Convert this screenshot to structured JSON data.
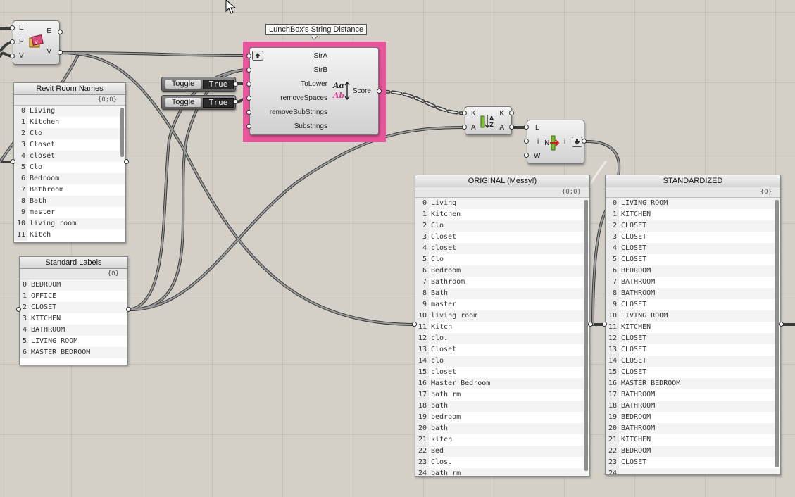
{
  "canvas": {
    "background": "#d4d0c8",
    "grid_color": "#c4c0b8",
    "highlight_color": "#e8559c"
  },
  "cursor": {
    "icon": "mouse-pointer-icon"
  },
  "object_component": {
    "inputs": [
      "E",
      "P",
      "V"
    ],
    "outputs": [
      "E",
      "V"
    ],
    "icon": "revit-object-icon"
  },
  "string_distance": {
    "tooltip": "LunchBox's String Distance",
    "inputs": [
      "StrA",
      "StrB",
      "ToLower",
      "removeSpaces",
      "removeSubStrings",
      "Substrings"
    ],
    "output": "Score",
    "icon": "case-convert-icon"
  },
  "toggles": [
    {
      "label": "Toggle",
      "value": "True"
    },
    {
      "label": "Toggle",
      "value": "True"
    }
  ],
  "sort_component": {
    "inputs": [
      "K",
      "A"
    ],
    "outputs": [
      "K",
      "A"
    ],
    "icon": "sort-az-icon"
  },
  "list_item_component": {
    "inputs": [
      "L",
      "i",
      "W"
    ],
    "output": "i",
    "icon": "list-item-icon"
  },
  "panels": {
    "revit_room_names": {
      "title": "Revit Room Names",
      "path": "{0;0}",
      "rows": [
        [
          "0",
          "Living"
        ],
        [
          "1",
          "Kitchen"
        ],
        [
          "2",
          "Clo"
        ],
        [
          "3",
          "Closet"
        ],
        [
          "4",
          "closet"
        ],
        [
          "5",
          "Clo"
        ],
        [
          "6",
          "Bedroom"
        ],
        [
          "7",
          "Bathroom"
        ],
        [
          "8",
          "Bath"
        ],
        [
          "9",
          "master"
        ],
        [
          "10",
          "living room"
        ],
        [
          "11",
          "Kitch"
        ]
      ]
    },
    "standard_labels": {
      "title": "Standard Labels",
      "path": "{0}",
      "rows": [
        [
          "0",
          "BEDROOM"
        ],
        [
          "1",
          "OFFICE"
        ],
        [
          "2",
          "CLOSET"
        ],
        [
          "3",
          "KITCHEN"
        ],
        [
          "4",
          "BATHROOM"
        ],
        [
          "5",
          "LIVING ROOM"
        ],
        [
          "6",
          "MASTER BEDROOM"
        ]
      ]
    },
    "original": {
      "title": "ORIGINAL (Messy!)",
      "path": "{0;0}",
      "rows": [
        [
          "0",
          "Living"
        ],
        [
          "1",
          "Kitchen"
        ],
        [
          "2",
          "Clo"
        ],
        [
          "3",
          "Closet"
        ],
        [
          "4",
          "closet"
        ],
        [
          "5",
          "Clo"
        ],
        [
          "6",
          "Bedroom"
        ],
        [
          "7",
          "Bathroom"
        ],
        [
          "8",
          "Bath"
        ],
        [
          "9",
          "master"
        ],
        [
          "10",
          "living room"
        ],
        [
          "11",
          "Kitch"
        ],
        [
          "12",
          "clo."
        ],
        [
          "13",
          "Closet"
        ],
        [
          "14",
          "clo"
        ],
        [
          "15",
          "closet"
        ],
        [
          "16",
          "Master Bedroom"
        ],
        [
          "17",
          "bath rm"
        ],
        [
          "18",
          "bath"
        ],
        [
          "19",
          "bedroom"
        ],
        [
          "20",
          "bath"
        ],
        [
          "21",
          "kitch"
        ],
        [
          "22",
          "Bed"
        ],
        [
          "23",
          "Clos."
        ],
        [
          "24",
          "bath rm"
        ]
      ]
    },
    "standardized": {
      "title": "STANDARDIZED",
      "path": "{0}",
      "rows": [
        [
          "0",
          "LIVING ROOM"
        ],
        [
          "1",
          "KITCHEN"
        ],
        [
          "2",
          "CLOSET"
        ],
        [
          "3",
          "CLOSET"
        ],
        [
          "4",
          "CLOSET"
        ],
        [
          "5",
          "CLOSET"
        ],
        [
          "6",
          "BEDROOM"
        ],
        [
          "7",
          "BATHROOM"
        ],
        [
          "8",
          "BATHROOM"
        ],
        [
          "9",
          "CLOSET"
        ],
        [
          "10",
          "LIVING ROOM"
        ],
        [
          "11",
          "KITCHEN"
        ],
        [
          "12",
          "CLOSET"
        ],
        [
          "13",
          "CLOSET"
        ],
        [
          "14",
          "CLOSET"
        ],
        [
          "15",
          "CLOSET"
        ],
        [
          "16",
          "MASTER BEDROOM"
        ],
        [
          "17",
          "BATHROOM"
        ],
        [
          "18",
          "BATHROOM"
        ],
        [
          "19",
          "BEDROOM"
        ],
        [
          "20",
          "BATHROOM"
        ],
        [
          "21",
          "KITCHEN"
        ],
        [
          "22",
          "BEDROOM"
        ],
        [
          "23",
          "CLOSET"
        ],
        [
          "24",
          ""
        ]
      ]
    }
  }
}
